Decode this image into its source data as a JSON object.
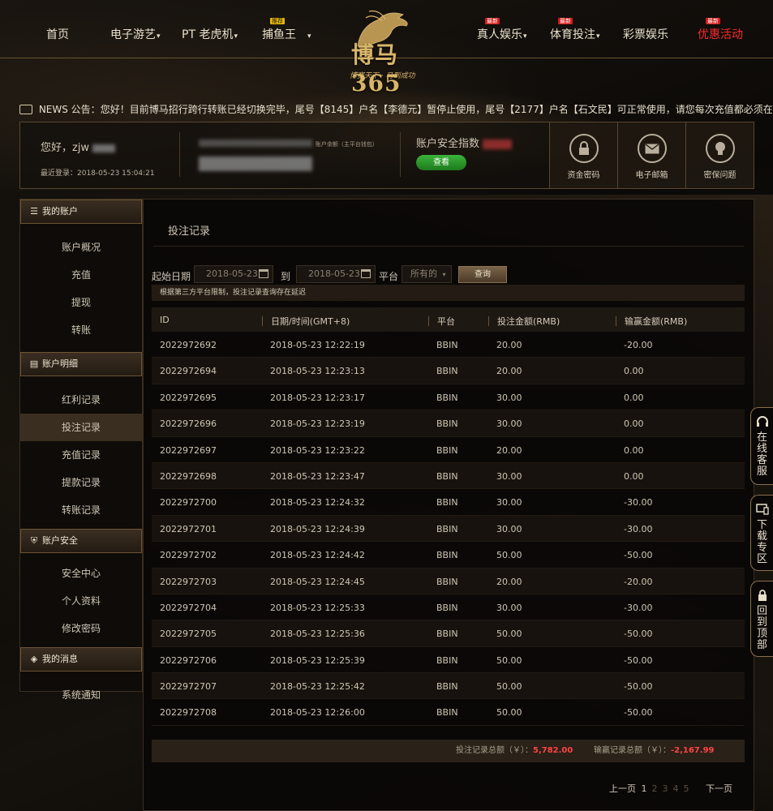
{
  "nav": {
    "items": [
      {
        "label": "首页"
      },
      {
        "label": "电子游艺"
      },
      {
        "label": "PT 老虎机"
      },
      {
        "label": "捕鱼王",
        "badge": "推荐"
      },
      {
        "label": "真人娱乐",
        "badge": "最新"
      },
      {
        "label": "体育投注",
        "badge": "最新"
      },
      {
        "label": "彩票娱乐"
      },
      {
        "label": "优惠活动",
        "badge": "最新",
        "color": "#ff2a2a"
      }
    ]
  },
  "logo": {
    "text": "博马 365",
    "slogan": "博赛天下 · 马到成功"
  },
  "notice": {
    "label": "NEWS 公告：",
    "text": "您好！目前博马招行跨行转账已经切换完毕，尾号【8145】户名【李德元】暂停止使用，尾号【2177】户名【石文民】可正常使用，请您每次充值都必须在前台获取最新收款"
  },
  "account": {
    "greeting": "您好，zjw",
    "last_login": "最近登录：2018-05-23 15:04:21",
    "wallet_caption": "账户余额（主平台钱包）",
    "safety_label": "账户安全指数",
    "view_button": "查看",
    "tools": [
      {
        "label": "资金密码",
        "icon": "lock-icon"
      },
      {
        "label": "电子邮箱",
        "icon": "mail-icon"
      },
      {
        "label": "密保问题",
        "icon": "bulb-icon"
      }
    ]
  },
  "sidebar": {
    "sections": [
      {
        "title": "我的账户",
        "icon": "account-icon",
        "items": [
          "账户概况",
          "充值",
          "提现",
          "转账"
        ]
      },
      {
        "title": "账户明细",
        "icon": "ledger-icon",
        "items": [
          "红利记录",
          "投注记录",
          "充值记录",
          "提款记录",
          "转账记录"
        ]
      },
      {
        "title": "账户安全",
        "icon": "shield-icon",
        "items": [
          "安全中心",
          "个人资料",
          "修改密码"
        ]
      },
      {
        "title": "我的消息",
        "icon": "message-icon",
        "items": [
          "系统通知"
        ]
      }
    ],
    "active_item": "投注记录"
  },
  "page": {
    "title": "投注记录",
    "filter": {
      "start_label": "起始日期",
      "start_date": "2018-05-23",
      "to_label": "到",
      "end_date": "2018-05-23",
      "platform_label": "平台",
      "platform_value": "所有的",
      "query_button": "查询"
    },
    "hint": "根据第三方平台限制，投注记录查询存在延迟",
    "columns": [
      "ID",
      "日期/时间(GMT+8)",
      "平台",
      "投注金额(RMB)",
      "输赢金额(RMB)"
    ],
    "rows": [
      [
        "2022972692",
        "2018-05-23 12:22:19",
        "BBIN",
        "20.00",
        "-20.00"
      ],
      [
        "2022972694",
        "2018-05-23 12:23:13",
        "BBIN",
        "20.00",
        "0.00"
      ],
      [
        "2022972695",
        "2018-05-23 12:23:17",
        "BBIN",
        "30.00",
        "0.00"
      ],
      [
        "2022972696",
        "2018-05-23 12:23:19",
        "BBIN",
        "30.00",
        "0.00"
      ],
      [
        "2022972697",
        "2018-05-23 12:23:22",
        "BBIN",
        "20.00",
        "0.00"
      ],
      [
        "2022972698",
        "2018-05-23 12:23:47",
        "BBIN",
        "30.00",
        "0.00"
      ],
      [
        "2022972700",
        "2018-05-23 12:24:32",
        "BBIN",
        "30.00",
        "-30.00"
      ],
      [
        "2022972701",
        "2018-05-23 12:24:39",
        "BBIN",
        "30.00",
        "-30.00"
      ],
      [
        "2022972702",
        "2018-05-23 12:24:42",
        "BBIN",
        "50.00",
        "-50.00"
      ],
      [
        "2022972703",
        "2018-05-23 12:24:45",
        "BBIN",
        "20.00",
        "-20.00"
      ],
      [
        "2022972704",
        "2018-05-23 12:25:33",
        "BBIN",
        "30.00",
        "-30.00"
      ],
      [
        "2022972705",
        "2018-05-23 12:25:36",
        "BBIN",
        "50.00",
        "-50.00"
      ],
      [
        "2022972706",
        "2018-05-23 12:25:39",
        "BBIN",
        "50.00",
        "-50.00"
      ],
      [
        "2022972707",
        "2018-05-23 12:25:42",
        "BBIN",
        "50.00",
        "-50.00"
      ],
      [
        "2022972708",
        "2018-05-23 12:26:00",
        "BBIN",
        "50.00",
        "-50.00"
      ]
    ],
    "totals": {
      "bet_label": "投注记录总额（￥）：",
      "bet_value": "5,782.00",
      "win_label": "输赢记录总额（￥）：",
      "win_value": "-2,167.99"
    },
    "pager": {
      "prev": "上一页",
      "pages": [
        "1",
        "2",
        "3",
        "4",
        "5"
      ],
      "next": "下一页"
    }
  },
  "float_tabs": [
    {
      "label": "在线客服",
      "icon": "headset-icon"
    },
    {
      "label": "下载专区",
      "icon": "monitor-icon"
    },
    {
      "label": "回到顶部",
      "icon": "lock-top-icon"
    }
  ]
}
